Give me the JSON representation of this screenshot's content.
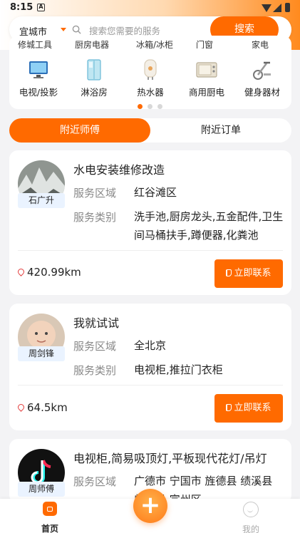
{
  "status_bar": {
    "time": "8:15"
  },
  "header": {
    "city": "宜城市",
    "search_placeholder": "搜索您需要的服务",
    "search_button": "搜索"
  },
  "categories": {
    "cut_row": [
      "修城工具",
      "厨房电器",
      "冰箱/冰柜",
      "门窗",
      "家电"
    ],
    "items": [
      {
        "label": "电视/投影",
        "icon": "tv-icon"
      },
      {
        "label": "淋浴房",
        "icon": "shower-room-icon"
      },
      {
        "label": "热水器",
        "icon": "water-heater-icon"
      },
      {
        "label": "商用厨电",
        "icon": "commercial-kitchen-icon"
      },
      {
        "label": "健身器材",
        "icon": "fitness-equipment-icon"
      }
    ],
    "page_indicator": {
      "pages": 3,
      "active": 1
    }
  },
  "tabs": [
    {
      "label": "附近师傅",
      "active": true
    },
    {
      "label": "附近订单",
      "active": false
    }
  ],
  "labels": {
    "area": "服务区域",
    "type": "服务类别",
    "contact": "立即联系"
  },
  "workers": [
    {
      "name": "石广升",
      "title": "水电安装维修改造",
      "area": "红谷滩区",
      "types": "洗手池,厨房龙头,五金配件,卫生间马桶扶手,蹲便器,化粪池",
      "distance": "420.99km"
    },
    {
      "name": "周剑锋",
      "title": "我就试试",
      "area": "全北京",
      "types": "电视柜,推拉门衣柜",
      "distance": "64.5km"
    },
    {
      "name": "周师傅",
      "title": "电视柜,简易吸顶灯,平板现代花灯/吊灯",
      "area": "广德市 宁国市 旌德县 绩溪县 郎溪县 宣州区"
    }
  ],
  "bottom_nav": {
    "home": "首页",
    "mine": "我的",
    "add": "+"
  },
  "colors": {
    "accent": "#ff6a00",
    "background": "#f3f3f5"
  }
}
